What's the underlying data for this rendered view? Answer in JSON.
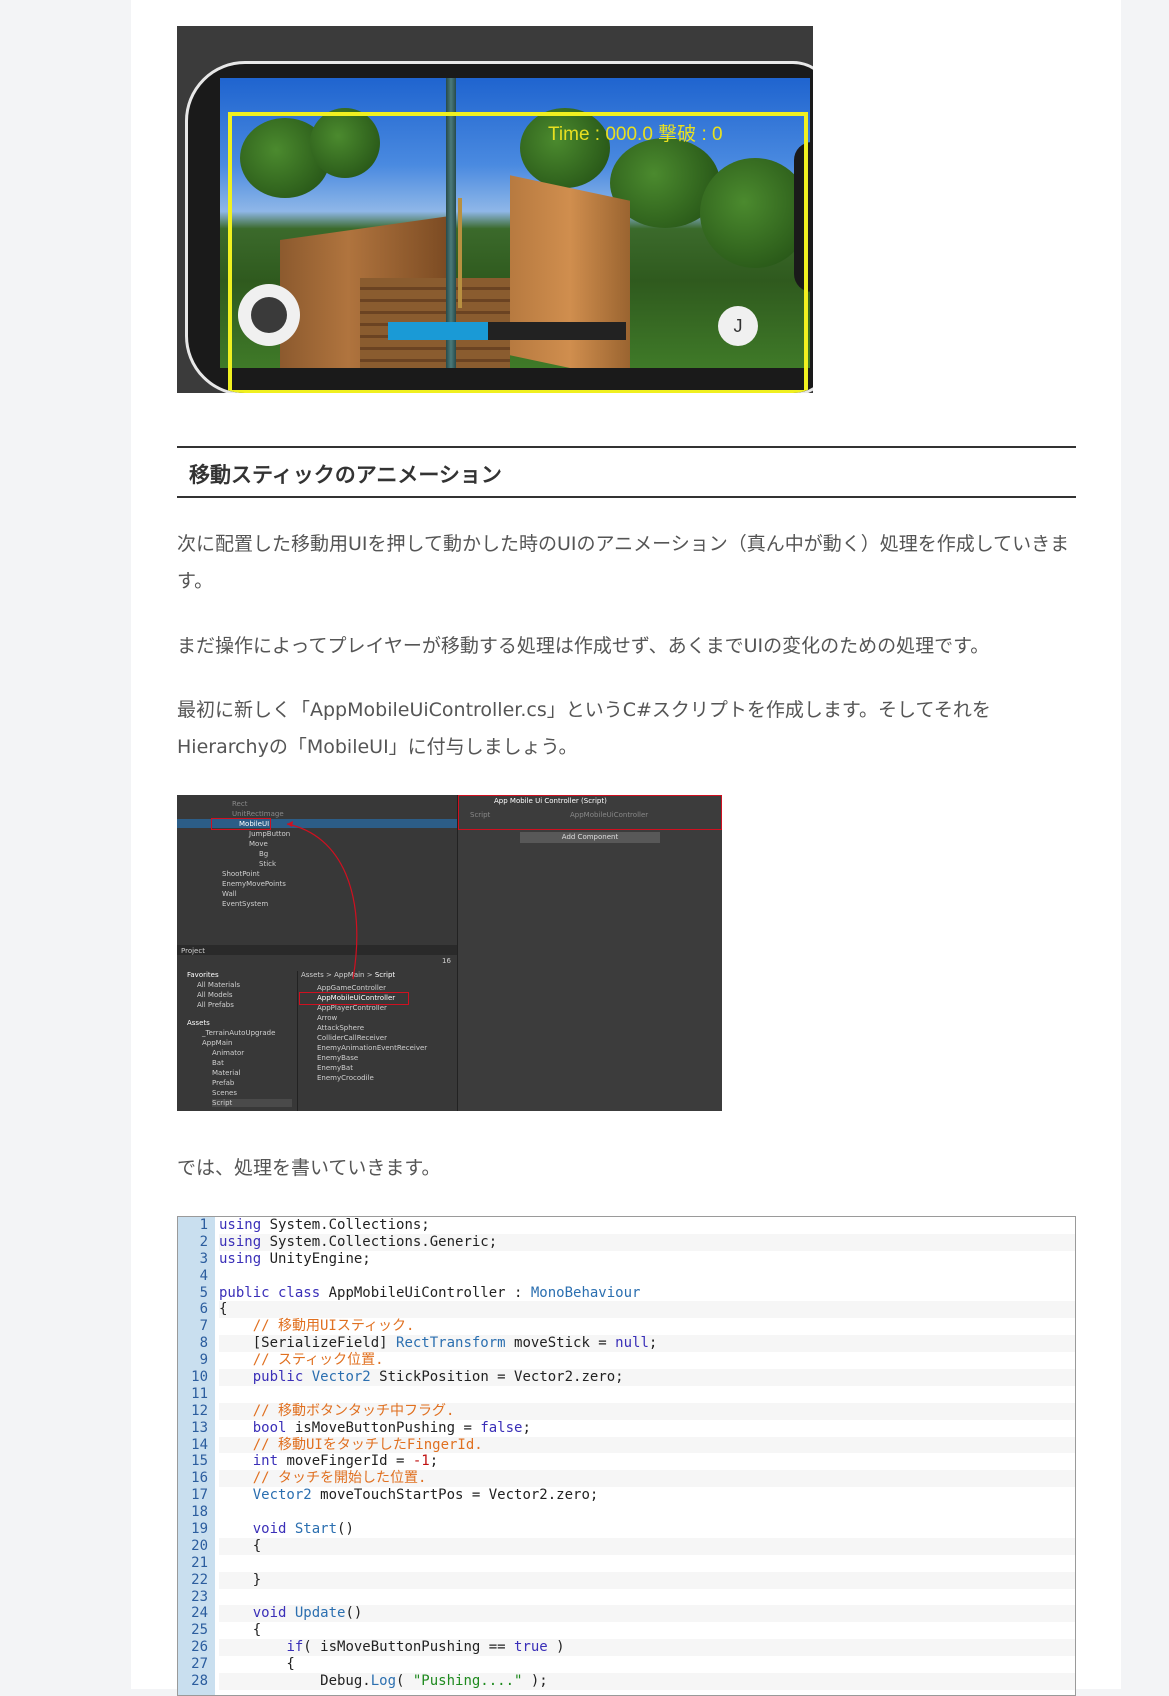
{
  "game": {
    "hud_time": "Time : 000.0 撃破 : 0",
    "jump_label": "J",
    "move_gauge_fill": 0.42
  },
  "heading": "移動スティックのアニメーション",
  "paragraphs": {
    "p1": "次に配置した移動用UIを押して動かした時のUIのアニメーション（真ん中が動く）処理を作成していきます。",
    "p2": "まだ操作によってプレイヤーが移動する処理は作成せず、あくまでUIの変化のための処理です。",
    "p3": "最初に新しく「AppMobileUiController.cs」というC#スクリプトを作成します。そしてそれをHierarchyの「MobileUI」に付与しましょう。",
    "p4": "では、処理を書いていきます。"
  },
  "unity": {
    "hierarchy": [
      "Rect",
      "UnitRectImage",
      "MobileUI",
      "JumpButton",
      "Move",
      "Bg",
      "Stick",
      "ShootPoint",
      "EnemyMovePoints",
      "Wall",
      "EventSystem"
    ],
    "project_tab": "Project",
    "project_count": "16",
    "favorites": "Favorites",
    "favorite_items": [
      "All Materials",
      "All Models",
      "All Prefabs"
    ],
    "assets": "Assets",
    "asset_tree": [
      "_TerrainAutoUpgrade",
      "AppMain",
      "Animator",
      "Bat",
      "Material",
      "Prefab",
      "Scenes",
      "Script"
    ],
    "breadcrumb": [
      "Assets",
      "AppMain",
      "Script"
    ],
    "scripts": [
      "AppGameController",
      "AppMobileUiController",
      "AppPlayerController",
      "Arrow",
      "AttackSphere",
      "ColliderCallReceiver",
      "EnemyAnimationEventReceiver",
      "EnemyBase",
      "EnemyBat",
      "EnemyCrocodile"
    ],
    "component_title": "App Mobile Ui Controller (Script)",
    "script_label": "Script",
    "script_value": "AppMobileUiController",
    "add_component": "Add Component"
  },
  "code_lines": [
    {
      "n": "1",
      "html": "<span class='kw'>using</span> System.Collections;"
    },
    {
      "n": "2",
      "html": "<span class='kw'>using</span> System.Collections.Generic;"
    },
    {
      "n": "3",
      "html": "<span class='kw'>using</span> UnityEngine;"
    },
    {
      "n": "4",
      "html": ""
    },
    {
      "n": "5",
      "html": "<span class='kw'>public class</span> AppMobileUiController : <span class='ty'>MonoBehaviour</span>"
    },
    {
      "n": "6",
      "html": "{"
    },
    {
      "n": "7",
      "html": "    <span class='cm'>// 移動用UIスティック.</span>"
    },
    {
      "n": "8",
      "html": "    [SerializeField] <span class='ty'>RectTransform</span> moveStick = <span class='kw'>null</span>;"
    },
    {
      "n": "9",
      "html": "    <span class='cm'>// スティック位置.</span>"
    },
    {
      "n": "10",
      "html": "    <span class='kw'>public</span> <span class='ty'>Vector2</span> StickPosition = Vector2.zero;"
    },
    {
      "n": "11",
      "html": ""
    },
    {
      "n": "12",
      "html": "    <span class='cm'>// 移動ボタンタッチ中フラグ.</span>"
    },
    {
      "n": "13",
      "html": "    <span class='kw'>bool</span> isMoveButtonPushing = <span class='kw'>false</span>;"
    },
    {
      "n": "14",
      "html": "    <span class='cm'>// 移動UIをタッチしたFingerId.</span>"
    },
    {
      "n": "15",
      "html": "    <span class='kw'>int</span> moveFingerId = <span class='nu'>-1</span>;"
    },
    {
      "n": "16",
      "html": "    <span class='cm'>// タッチを開始した位置.</span>"
    },
    {
      "n": "17",
      "html": "    <span class='ty'>Vector2</span> moveTouchStartPos = Vector2.zero;"
    },
    {
      "n": "18",
      "html": ""
    },
    {
      "n": "19",
      "html": "    <span class='kw'>void</span> <span class='ty'>Start</span>()"
    },
    {
      "n": "20",
      "html": "    {"
    },
    {
      "n": "21",
      "html": ""
    },
    {
      "n": "22",
      "html": "    }"
    },
    {
      "n": "23",
      "html": ""
    },
    {
      "n": "24",
      "html": "    <span class='kw'>void</span> <span class='ty'>Update</span>()"
    },
    {
      "n": "25",
      "html": "    {"
    },
    {
      "n": "26",
      "html": "        <span class='kw'>if</span>( isMoveButtonPushing == <span class='kw'>true</span> )"
    },
    {
      "n": "27",
      "html": "        {"
    },
    {
      "n": "28",
      "html": "            Debug.<span class='ty'>Log</span>( <span class='st'>\"Pushing....\"</span> );"
    }
  ]
}
